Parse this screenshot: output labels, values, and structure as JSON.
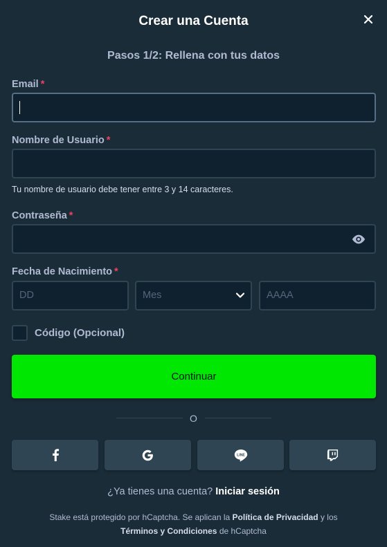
{
  "modal": {
    "title": "Crear una Cuenta",
    "subtitle": "Pasos 1/2: Rellena con tus datos"
  },
  "form": {
    "email_label": "Email",
    "username_label": "Nombre de Usuario",
    "username_hint": "Tu nombre de usuario debe tener entre 3 y 14 caracteres.",
    "password_label": "Contraseña",
    "dob_label": "Fecha de Nacimiento",
    "required_marker": "*",
    "day_placeholder": "DD",
    "month_placeholder": "Mes",
    "year_placeholder": "AAAA",
    "code_label": "Código (Opcional)",
    "submit_label": "Continuar"
  },
  "divider_text": "O",
  "social": [
    {
      "icon": "facebook-icon"
    },
    {
      "icon": "google-icon"
    },
    {
      "icon": "line-icon"
    },
    {
      "icon": "twitch-icon"
    }
  ],
  "login_prompt": {
    "question": "¿Ya tienes una cuenta?",
    "link": "Iniciar sesión"
  },
  "legal": {
    "prefix": "Stake está protegido por hCaptcha. Se aplican la",
    "privacy_link": "Política de Privacidad",
    "and": "y los",
    "terms_link": "Términos y Condiciones",
    "suffix": "de hCaptcha"
  },
  "colors": {
    "background": "#1a2c38",
    "input_bg": "#0f212e",
    "border": "#2f4553",
    "accent_green": "#00e701",
    "required_red": "#ed4163"
  }
}
